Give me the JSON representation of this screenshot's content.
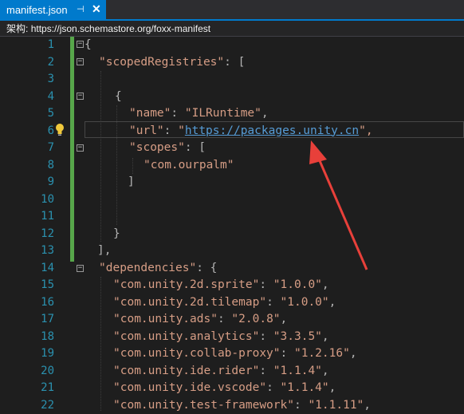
{
  "tab": {
    "title": "manifest.json",
    "pin": "⊣",
    "close": "✕"
  },
  "schema": {
    "label": "架构:",
    "url": "https://json.schemastore.org/foxx-manifest"
  },
  "line_numbers": [
    "1",
    "2",
    "3",
    "4",
    "5",
    "6",
    "7",
    "8",
    "9",
    "10",
    "11",
    "12",
    "13",
    "14",
    "15",
    "16",
    "17",
    "18",
    "19",
    "20",
    "21",
    "22"
  ],
  "code": {
    "l1": "{",
    "l2_key": "\"scopedRegistries\"",
    "l2_rest": ": [",
    "l4": "{",
    "l5_key": "\"name\"",
    "l5_sep": ": ",
    "l5_val": "\"ILRuntime\"",
    "l5_end": ",",
    "l6_key": "\"url\"",
    "l6_sep": ": ",
    "l6_q1": "\"",
    "l6_url": "https://packages.unity.cn",
    "l6_q2": "\",",
    "l7_key": "\"scopes\"",
    "l7_rest": ": [",
    "l8_val": "\"com.ourpalm\"",
    "l9": "]",
    "l12": "}",
    "l13": "],",
    "l14_key": "\"dependencies\"",
    "l14_rest": ": {",
    "deps": [
      {
        "key": "\"com.unity.2d.sprite\"",
        "val": "\"1.0.0\""
      },
      {
        "key": "\"com.unity.2d.tilemap\"",
        "val": "\"1.0.0\""
      },
      {
        "key": "\"com.unity.ads\"",
        "val": "\"2.0.8\""
      },
      {
        "key": "\"com.unity.analytics\"",
        "val": "\"3.3.5\""
      },
      {
        "key": "\"com.unity.collab-proxy\"",
        "val": "\"1.2.16\""
      },
      {
        "key": "\"com.unity.ide.rider\"",
        "val": "\"1.1.4\""
      },
      {
        "key": "\"com.unity.ide.vscode\"",
        "val": "\"1.1.4\""
      },
      {
        "key": "\"com.unity.test-framework\"",
        "val": "\"1.1.11\""
      }
    ],
    "dep_sep": ": ",
    "dep_end": ","
  },
  "colors": {
    "accent": "#007acc",
    "string": "#d69d85",
    "url": "#569cd6",
    "annotation_arrow": "#e8403a"
  },
  "icons": {
    "lightbulb": "lightbulb-icon",
    "arrow": "annotation-arrow"
  }
}
